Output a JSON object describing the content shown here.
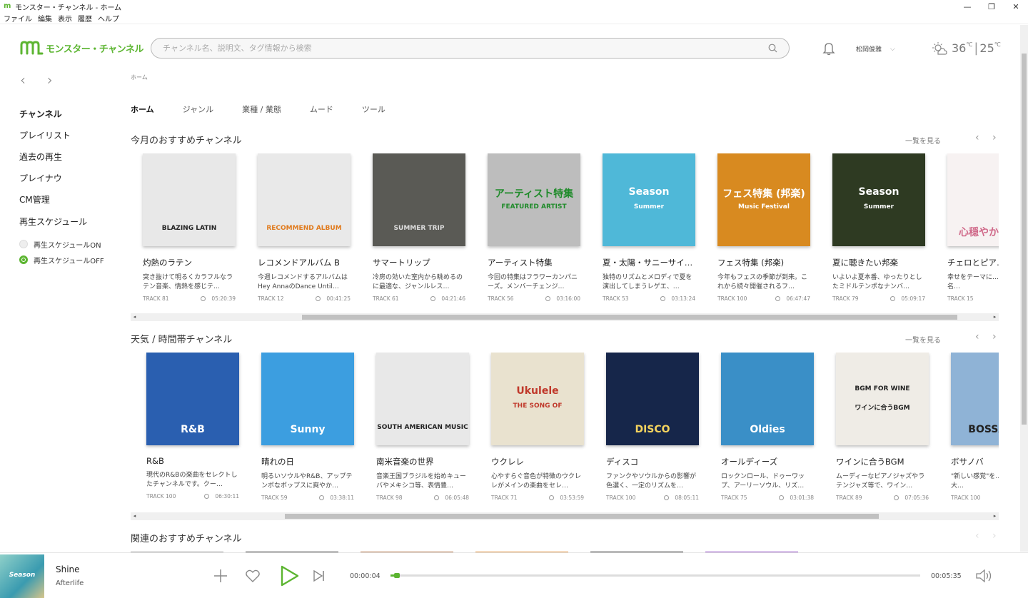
{
  "window": {
    "title": "モンスター・チャンネル - ホーム"
  },
  "menu": [
    "ファイル",
    "編集",
    "表示",
    "履歴",
    "ヘルプ"
  ],
  "header": {
    "logo_text": "モンスター・チャンネル",
    "search_placeholder": "チャンネル名、説明文、タグ情報から検索",
    "user_name": "松岡俊雅",
    "weather": {
      "high": "36",
      "low": "25",
      "unit": "℃"
    }
  },
  "sidebar": {
    "items": [
      "チャンネル",
      "プレイリスト",
      "過去の再生",
      "プレイナウ",
      "CM管理",
      "再生スケジュール"
    ],
    "schedule": [
      "再生スケジュールON",
      "再生スケジュールOFF"
    ]
  },
  "breadcrumb": "ホーム",
  "tabs": [
    "ホーム",
    "ジャンル",
    "業種 / 業態",
    "ムード",
    "ツール"
  ],
  "see_all": "一覧を見る",
  "sections": [
    {
      "title": "今月のおすすめチャンネル",
      "cards": [
        {
          "name": "灼熱のラテン",
          "art_text": "BLAZING LATIN",
          "desc": "突き抜けて明るくカラフルなラテン音楽、情熱を感じテ…",
          "tracks": "TRACK 81",
          "duration": "05:20:39",
          "art_bg": "#e8e8e8",
          "art_fg": "#222"
        },
        {
          "name": "レコメンドアルバム B",
          "art_text": "RECOMMEND ALBUM",
          "desc": "今週レコメンドするアルバムはHey AnnaのDance Until…",
          "tracks": "TRACK 12",
          "duration": "00:41:25",
          "art_bg": "#e9e9e9",
          "art_fg": "#e07a1c"
        },
        {
          "name": "サマートリップ",
          "art_text": "SUMMER TRIP",
          "desc": "冷房の効いた室内から眺めるのに最適な、ジャンルレス…",
          "tracks": "TRACK 61",
          "duration": "04:21:46",
          "art_bg": "#5a5a55",
          "art_fg": "#ddd"
        },
        {
          "name": "アーティスト特集",
          "art_text": "アーティスト特集",
          "art_sub": "FEATURED ARTIST",
          "desc": "今回の特集はフラワーカンパニーズ。メンバーチェンジ…",
          "tracks": "TRACK 56",
          "duration": "03:16:00",
          "art_bg": "#bdbdbd",
          "art_fg": "#1f8b2a"
        },
        {
          "name": "夏・太陽・サニーサイ…",
          "art_text": "Season",
          "art_sub": "Summer",
          "desc": "独特のリズムとメロディで夏を演出してしまうレゲエ、…",
          "tracks": "TRACK 53",
          "duration": "03:13:24",
          "art_bg": "#4fb8d8",
          "art_fg": "#fff"
        },
        {
          "name": "フェス特集 (邦楽)",
          "art_text": "フェス特集 (邦楽)",
          "art_sub": "Music Festival",
          "desc": "今年もフェスの季節が到来。これから続々開催されるフ…",
          "tracks": "TRACK 100",
          "duration": "06:47:47",
          "art_bg": "#d88a20",
          "art_fg": "#fff"
        },
        {
          "name": "夏に聴きたい邦楽",
          "art_text": "Season",
          "art_sub": "Summer",
          "desc": "いよいよ夏本番、ゆったりとしたミドルテンポなナンバ…",
          "tracks": "TRACK 79",
          "duration": "05:09:17",
          "art_bg": "#2e3a22",
          "art_fg": "#fff"
        },
        {
          "name": "チェロとピア…",
          "art_text": "心穏やかになる",
          "desc": "幸せをテーマに…ラブソングの名…",
          "tracks": "TRACK 15",
          "duration": "",
          "art_bg": "#f7f2f2",
          "art_fg": "#d06a8a"
        }
      ]
    },
    {
      "title": "天気 / 時間帯チャンネル",
      "cards": [
        {
          "name": "R&B",
          "art_text": "R&B",
          "desc": "現代のR&Bの楽曲をセレクトしたチャンネルです。クー…",
          "tracks": "TRACK 100",
          "duration": "06:30:11",
          "art_bg": "#2a5fb0",
          "art_fg": "#fff"
        },
        {
          "name": "晴れの日",
          "art_text": "Sunny",
          "desc": "明るいソウルやR&B、アップテンポなポップスに爽やか…",
          "tracks": "TRACK 59",
          "duration": "03:38:11",
          "art_bg": "#3c9ee0",
          "art_fg": "#fff"
        },
        {
          "name": "南米音楽の世界",
          "art_text": "SOUTH AMERICAN MUSIC",
          "desc": "音楽王国ブラジルを始めキューバやメキシコ等、表情豊…",
          "tracks": "TRACK 98",
          "duration": "06:05:48",
          "art_bg": "#e8e8e8",
          "art_fg": "#222"
        },
        {
          "name": "ウクレレ",
          "art_text": "Ukulele",
          "art_sub": "THE SONG OF",
          "desc": "心やすらぐ音色が特徴のウクレレがメインの楽曲をセレ…",
          "tracks": "TRACK 71",
          "duration": "03:53:59",
          "art_bg": "#e9e2cf",
          "art_fg": "#c0392b"
        },
        {
          "name": "ディスコ",
          "art_text": "DISCO",
          "desc": "ファンクやソウルからの影響が色濃く、一定のリズムを…",
          "tracks": "TRACK 100",
          "duration": "08:05:11",
          "art_bg": "#16264a",
          "art_fg": "#f4d35e"
        },
        {
          "name": "オールディーズ",
          "art_text": "Oldies",
          "desc": "ロックンロール、ドゥーワップ、アーリーソウル、リズ…",
          "tracks": "TRACK 75",
          "duration": "03:01:38",
          "art_bg": "#3a8fc7",
          "art_fg": "#fff"
        },
        {
          "name": "ワインに合うBGM",
          "art_text": "BGM FOR WINE",
          "art_sub": "ワインに合うBGM",
          "desc": "ムーディーなピアノジャズやラテンジャズ等で、ワイン…",
          "tracks": "TRACK 89",
          "duration": "07:05:36",
          "art_bg": "#efece6",
          "art_fg": "#222"
        },
        {
          "name": "ボサノバ",
          "art_text": "BOSSA NO",
          "desc": "\"新しい感覚\"を…ノバ、音楽大…",
          "tracks": "TRACK 100",
          "duration": "",
          "art_bg": "#8fb3d6",
          "art_fg": "#222"
        }
      ]
    },
    {
      "title": "関連のおすすめチャンネル"
    }
  ],
  "player": {
    "thumb_text": "Season",
    "song": "Shine",
    "artist": "Afterlife",
    "elapsed": "00:00:04",
    "total": "00:05:35",
    "progress": 0.012
  },
  "colors": {
    "accent": "#5cb531"
  }
}
